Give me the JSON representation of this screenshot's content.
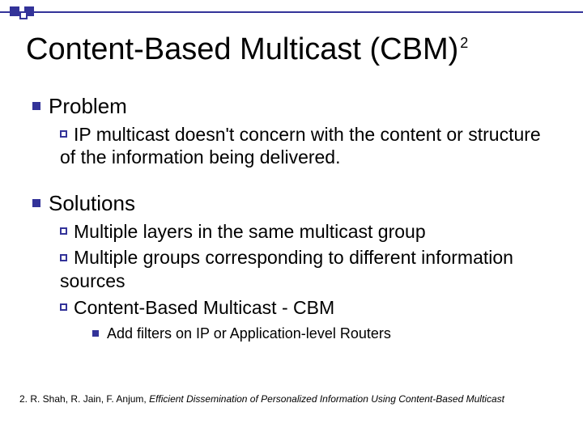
{
  "title_main": "Content-Based Multicast (CBM)",
  "title_sup": "2",
  "sections": {
    "problem": {
      "heading": "Problem",
      "items": [
        "IP multicast doesn't concern with the content or structure of the information being delivered."
      ]
    },
    "solutions": {
      "heading": "Solutions",
      "items": [
        "Multiple layers in the same multicast group",
        "Multiple groups corresponding to different information sources",
        "Content-Based Multicast - CBM"
      ],
      "sub_of_last": [
        "Add filters on IP or Application-level Routers"
      ]
    }
  },
  "footnote_num": "2. ",
  "footnote_authors": "R. Shah, R. Jain, F. Anjum, ",
  "footnote_title": "Efficient Dissemination of Personalized Information Using Content-Based Multicast"
}
